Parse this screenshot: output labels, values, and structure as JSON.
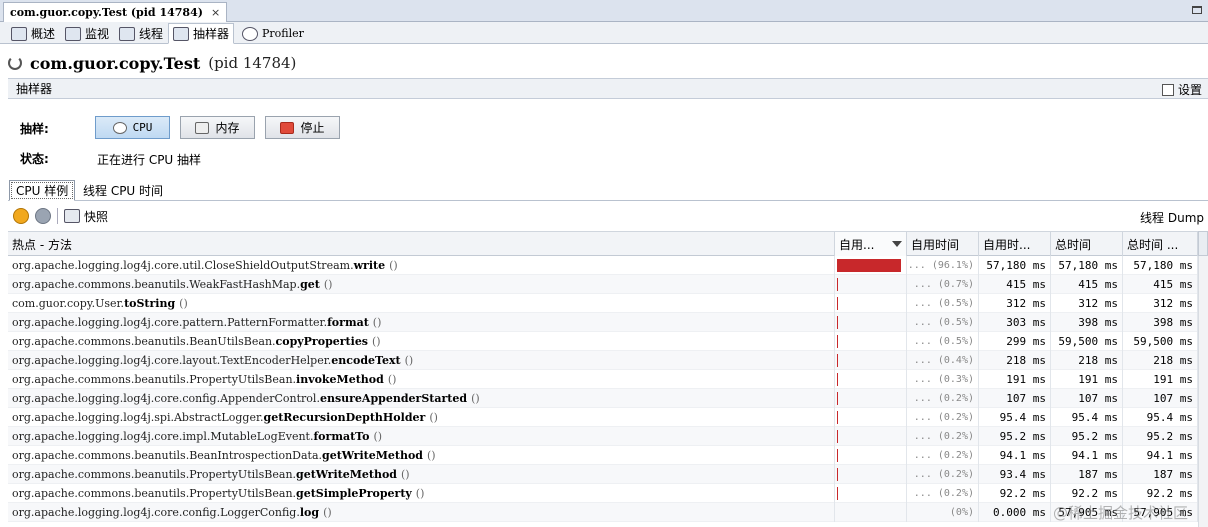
{
  "doc_tab": {
    "title": "com.guor.copy.Test (pid 14784)",
    "close": "×"
  },
  "subtabs": [
    {
      "label": "概述",
      "icon": "overview-icon"
    },
    {
      "label": "监视",
      "icon": "monitor-icon"
    },
    {
      "label": "线程",
      "icon": "threads-icon"
    },
    {
      "label": "抽样器",
      "icon": "sampler-icon",
      "active": true
    },
    {
      "label": "Profiler",
      "icon": "profiler-icon"
    }
  ],
  "header": {
    "app": "com.guor.copy.Test",
    "pid": "(pid 14784)"
  },
  "section": {
    "title": "抽样器",
    "settings": "设置"
  },
  "sampling": {
    "label": "抽样:",
    "cpu_button": "CPU",
    "memory_button": "内存",
    "stop_button": "停止",
    "status_label": "状态:",
    "status_text": "正在进行 CPU 抽样"
  },
  "inner_tabs": {
    "cpu_samples": "CPU 样例",
    "thread_cpu_time": "线程 CPU 时间"
  },
  "toolbar": {
    "snapshot": "快照",
    "thread_dump": "线程 Dump"
  },
  "table": {
    "columns": [
      "热点 - 方法",
      "自用...",
      "自用时间",
      "自用时...",
      "总时间",
      "总时间 ..."
    ],
    "rows": [
      {
        "pkg": "org.apache.logging.log4j.core.util.CloseShieldOutputStream.",
        "name": "write",
        "args": "()",
        "pct": "... (96.1%)",
        "share": 0.961,
        "self_time": "57,180 ms",
        "self_cpu": "57,180 ms",
        "total": "57,180 ms"
      },
      {
        "pkg": "org.apache.commons.beanutils.WeakFastHashMap.",
        "name": "get",
        "args": "()",
        "pct": "... (0.7%)",
        "share": 0.007,
        "self_time": "415 ms",
        "self_cpu": "415 ms",
        "total": "415 ms"
      },
      {
        "pkg": "com.guor.copy.User.",
        "name": "toString",
        "args": "()",
        "pct": "... (0.5%)",
        "share": 0.005,
        "self_time": "312 ms",
        "self_cpu": "312 ms",
        "total": "312 ms"
      },
      {
        "pkg": "org.apache.logging.log4j.core.pattern.PatternFormatter.",
        "name": "format",
        "args": "()",
        "pct": "... (0.5%)",
        "share": 0.005,
        "self_time": "303 ms",
        "self_cpu": "398 ms",
        "total": "398 ms"
      },
      {
        "pkg": "org.apache.commons.beanutils.BeanUtilsBean.",
        "name": "copyProperties",
        "args": "()",
        "pct": "... (0.5%)",
        "share": 0.005,
        "self_time": "299 ms",
        "self_cpu": "59,500 ms",
        "total": "59,500 ms"
      },
      {
        "pkg": "org.apache.logging.log4j.core.layout.TextEncoderHelper.",
        "name": "encodeText",
        "args": "()",
        "pct": "... (0.4%)",
        "share": 0.004,
        "self_time": "218 ms",
        "self_cpu": "218 ms",
        "total": "218 ms"
      },
      {
        "pkg": "org.apache.commons.beanutils.PropertyUtilsBean.",
        "name": "invokeMethod",
        "args": "()",
        "pct": "... (0.3%)",
        "share": 0.003,
        "self_time": "191 ms",
        "self_cpu": "191 ms",
        "total": "191 ms"
      },
      {
        "pkg": "org.apache.logging.log4j.core.config.AppenderControl.",
        "name": "ensureAppenderStarted",
        "args": "()",
        "pct": "... (0.2%)",
        "share": 0.002,
        "self_time": "107 ms",
        "self_cpu": "107 ms",
        "total": "107 ms"
      },
      {
        "pkg": "org.apache.logging.log4j.spi.AbstractLogger.",
        "name": "getRecursionDepthHolder",
        "args": "()",
        "pct": "... (0.2%)",
        "share": 0.002,
        "self_time": "95.4 ms",
        "self_cpu": "95.4 ms",
        "total": "95.4 ms"
      },
      {
        "pkg": "org.apache.logging.log4j.core.impl.MutableLogEvent.",
        "name": "formatTo",
        "args": "()",
        "pct": "... (0.2%)",
        "share": 0.002,
        "self_time": "95.2 ms",
        "self_cpu": "95.2 ms",
        "total": "95.2 ms"
      },
      {
        "pkg": "org.apache.commons.beanutils.BeanIntrospectionData.",
        "name": "getWriteMethod",
        "args": "()",
        "pct": "... (0.2%)",
        "share": 0.002,
        "self_time": "94.1 ms",
        "self_cpu": "94.1 ms",
        "total": "94.1 ms"
      },
      {
        "pkg": "org.apache.commons.beanutils.PropertyUtilsBean.",
        "name": "getWriteMethod",
        "args": "()",
        "pct": "... (0.2%)",
        "share": 0.002,
        "self_time": "93.4 ms",
        "self_cpu": "187 ms",
        "total": "187 ms"
      },
      {
        "pkg": "org.apache.commons.beanutils.PropertyUtilsBean.",
        "name": "getSimpleProperty",
        "args": "()",
        "pct": "... (0.2%)",
        "share": 0.002,
        "self_time": "92.2 ms",
        "self_cpu": "92.2 ms",
        "total": "92.2 ms"
      },
      {
        "pkg": "org.apache.logging.log4j.core.config.LoggerConfig.",
        "name": "log",
        "args": "()",
        "pct": "(0%)",
        "share": 0.0,
        "self_time": "0.000 ms",
        "self_cpu": "57,905 ms",
        "total": "57,905 ms"
      }
    ]
  },
  "watermark": "@稀土掘金技术社区",
  "colors": {
    "bar": "#c8282b",
    "accent": "#bfd9f2"
  }
}
